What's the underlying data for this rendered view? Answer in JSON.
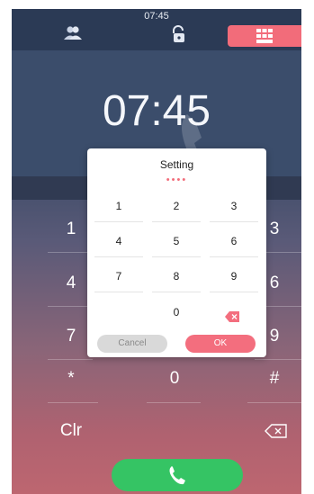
{
  "status": {
    "time": "07:45"
  },
  "toolbar": {
    "contacts_icon": "contacts-icon",
    "lock_icon": "unlock-icon",
    "keypad_icon": "keypad-icon"
  },
  "clock": {
    "time": "07:45"
  },
  "background_keypad": {
    "keys": [
      "1",
      "3",
      "4",
      "6",
      "7",
      "9",
      "*",
      "0",
      "#"
    ],
    "clear_label": "Clr",
    "backspace_icon": "backspace-icon"
  },
  "call": {
    "icon": "phone-icon"
  },
  "modal": {
    "title": "Setting",
    "pin_mask": "••••",
    "keys": [
      "1",
      "2",
      "3",
      "4",
      "5",
      "6",
      "7",
      "8",
      "9",
      "0"
    ],
    "delete_icon": "delete-icon",
    "cancel_label": "Cancel",
    "ok_label": "OK"
  },
  "colors": {
    "accent": "#f26c7a",
    "call_green": "#35c464"
  }
}
